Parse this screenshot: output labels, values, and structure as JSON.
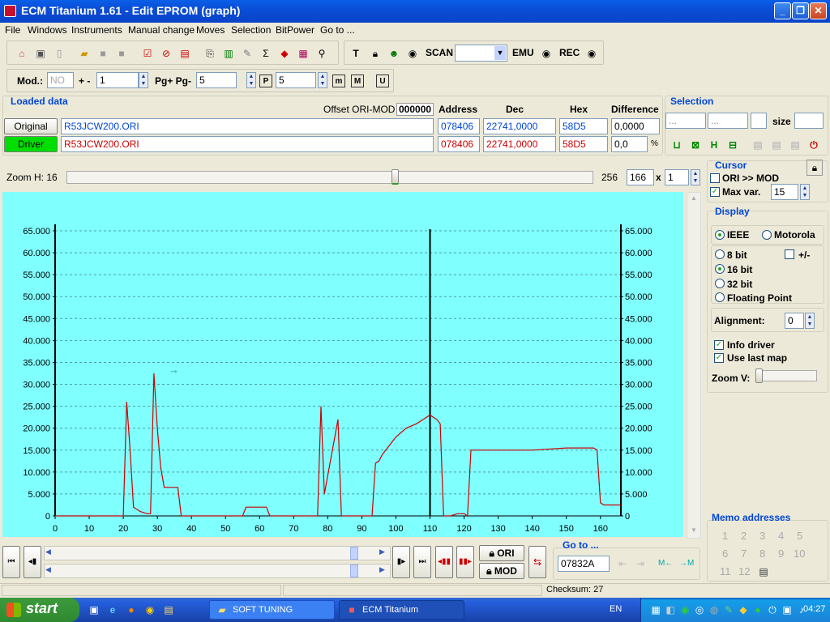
{
  "window": {
    "title": "ECM Titanium 1.61 - Edit EPROM (graph)"
  },
  "menu": [
    "File",
    "Windows",
    "Instruments",
    "Manual change",
    "Moves",
    "Selection",
    "BitPower",
    "Go to ..."
  ],
  "toolbar": {
    "scan_label": "SCAN",
    "emu_label": "EMU",
    "rec_label": "REC"
  },
  "modbar": {
    "mod_label": "Mod.:",
    "mod_value": "NO",
    "plusminus_label": "+ -",
    "plusminus_value": "1",
    "pg_label": "Pg+ Pg-",
    "pg_value": "5",
    "p_value": "5"
  },
  "loaded": {
    "title": "Loaded data",
    "offset_label": "Offset ORI-MOD",
    "offset_value": "000000",
    "columns": {
      "address": "Address",
      "dec": "Dec",
      "hex": "Hex",
      "difference": "Difference"
    },
    "original": {
      "label": "Original",
      "file": "R53JCW200.ORI",
      "address": "078406",
      "dec": "22741,0000",
      "hex": "58D5",
      "difference": "0,0000"
    },
    "driver": {
      "label": "Driver",
      "file": "R53JCW200.ORI",
      "address": "078406",
      "dec": "22741,0000",
      "hex": "58D5",
      "difference": "0,0",
      "pct": "%"
    }
  },
  "selection": {
    "title": "Selection",
    "from": "...",
    "to": "...",
    "size_label": "size"
  },
  "zoom": {
    "label": "Zoom H: 16",
    "max": "256",
    "value": "166",
    "times": "x",
    "mult": "1"
  },
  "cursor": {
    "title": "Cursor",
    "ori_mod": "ORI >> MOD",
    "maxvar": "Max var.",
    "maxvar_value": "15"
  },
  "display": {
    "title": "Display",
    "ieee": "IEEE",
    "motorola": "Motorola",
    "bit8": "8 bit",
    "plusminus": "+/-",
    "bit16": "16 bit",
    "bit32": "32 bit",
    "float": "Floating Point",
    "alignment_label": "Alignment:",
    "alignment_value": "0",
    "info_driver": "Info driver",
    "use_last_map": "Use last map",
    "zoom_v": "Zoom V:"
  },
  "memo": {
    "title": "Memo addresses",
    "items": [
      "1",
      "2",
      "3",
      "4",
      "5",
      "6",
      "7",
      "8",
      "9",
      "10",
      "11",
      "12"
    ]
  },
  "nav": {
    "ori_label": "ORI",
    "mod_label": "MOD",
    "goto_title": "Go to ...",
    "goto_value": "07832A"
  },
  "status": {
    "checksum": "Checksum: 27"
  },
  "taskbar": {
    "start": "start",
    "tasks": [
      "SOFT TUNING",
      "ECM Titanium"
    ],
    "lang": "EN",
    "clock": "04:27"
  },
  "colors": {
    "chart_bg": "#80ffff",
    "line": "#cc0000",
    "grid": "#4aa0a0",
    "driver_green": "#00dd00"
  },
  "chart_data": {
    "type": "line",
    "x": [
      0,
      20,
      21,
      22,
      23,
      25,
      27,
      28,
      29,
      30,
      31,
      32,
      36,
      37,
      38,
      54,
      55,
      56,
      62,
      63,
      64,
      77,
      78,
      79,
      83,
      84,
      85,
      93,
      94,
      95,
      96,
      100,
      103,
      106,
      107,
      108,
      110,
      111,
      112,
      113,
      114,
      115,
      116,
      118,
      120,
      121,
      122,
      123,
      140,
      150,
      151,
      157,
      158,
      159,
      160,
      161,
      166
    ],
    "y": [
      0,
      0,
      26000,
      15000,
      2000,
      1000,
      500,
      500,
      32500,
      20000,
      11000,
      6500,
      6500,
      0,
      0,
      0,
      0,
      2000,
      2000,
      0,
      0,
      0,
      25000,
      5000,
      22000,
      0,
      0,
      0,
      12000,
      12500,
      14000,
      18000,
      20000,
      21000,
      21500,
      22000,
      23000,
      22500,
      22000,
      21000,
      0,
      0,
      0,
      500,
      500,
      0,
      15000,
      15000,
      15000,
      15500,
      15500,
      15500,
      15500,
      15000,
      3000,
      2500,
      2500
    ],
    "xticks": [
      0,
      10,
      20,
      30,
      40,
      50,
      60,
      70,
      80,
      90,
      100,
      110,
      120,
      130,
      140,
      150,
      160
    ],
    "yticks": [
      "0",
      "5.000",
      "10.000",
      "15.000",
      "20.000",
      "25.000",
      "30.000",
      "35.000",
      "40.000",
      "45.000",
      "50.000",
      "55.000",
      "60.000",
      "65.000"
    ],
    "ylim": [
      0,
      65000
    ],
    "xlim": [
      0,
      166
    ],
    "cursor_x": 110,
    "grid": true
  }
}
